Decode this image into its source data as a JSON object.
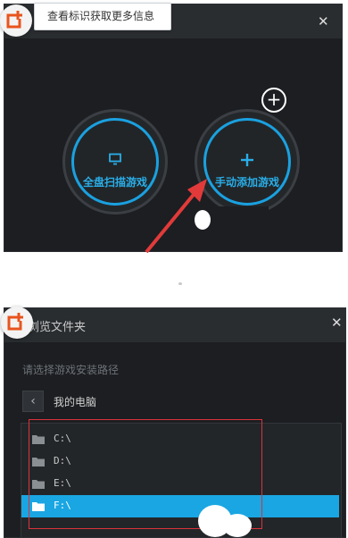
{
  "top_dialog": {
    "tooltip_text": "查看标识获取更多信息",
    "buttons": [
      {
        "label": "全盘扫描游戏",
        "icon": "monitor-icon"
      },
      {
        "label": "手动添加游戏",
        "icon": "plus-icon"
      }
    ],
    "floating_icon": "add-circle-icon"
  },
  "bottom_dialog": {
    "title": "浏览文件夹",
    "prompt": "请选择游戏安装路径",
    "location": "我的电脑",
    "folders": [
      {
        "label": "C:\\",
        "selected": false
      },
      {
        "label": "D:\\",
        "selected": false
      },
      {
        "label": "E:\\",
        "selected": false
      },
      {
        "label": "F:\\",
        "selected": true
      }
    ]
  },
  "colors": {
    "accent": "#1aa6e2",
    "background": "#1c1e21",
    "annotation": "#d8333a",
    "badge": "#e8541e"
  }
}
